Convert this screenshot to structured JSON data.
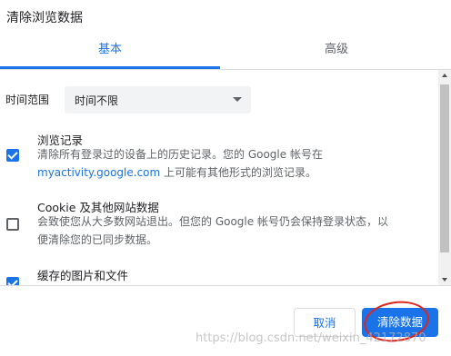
{
  "dialog": {
    "title": "清除浏览数据"
  },
  "tabs": [
    {
      "label": "基本"
    },
    {
      "label": "高级"
    }
  ],
  "time_range": {
    "label": "时间范围",
    "value": "时间不限"
  },
  "items": [
    {
      "title": "浏览记录",
      "checked": true,
      "desc_line1": "清除所有登录过的设备上的历史记录。您的 Google 帐号在",
      "desc_link": "myactivity.google.com",
      "desc_line2_rest": " 上可能有其他形式的浏览记录。"
    },
    {
      "title": "Cookie 及其他网站数据",
      "checked": false,
      "desc_line1": "会致使您从大多数网站退出。但您的 Google 帐号仍会保持登录状态，以",
      "desc_line2": "便清除您的已同步数据。"
    },
    {
      "title": "缓存的图片和文件",
      "checked": true
    }
  ],
  "buttons": {
    "cancel": "取消",
    "clear": "清除数据"
  },
  "watermark": "https://blog.csdn.net/weixin_42172870",
  "colors": {
    "accent": "#1a73e8",
    "annotation": "#e0261b"
  }
}
